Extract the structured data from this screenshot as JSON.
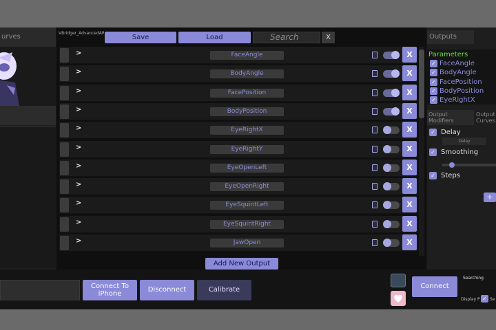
{
  "left_panel": {
    "tab_label": "urves"
  },
  "file": {
    "name": "VBridger_AdvancedARKit_V3.0"
  },
  "toolbar": {
    "save_label": "Save",
    "load_label": "Load",
    "search_placeholder": "Search",
    "search_clear": "X"
  },
  "outputs": [
    {
      "name": "FaceAngle",
      "enabled": true
    },
    {
      "name": "BodyAngle",
      "enabled": true
    },
    {
      "name": "FacePosition",
      "enabled": true
    },
    {
      "name": "BodyPosition",
      "enabled": true
    },
    {
      "name": "EyeRightX",
      "enabled": false
    },
    {
      "name": "EyeRightY",
      "enabled": false
    },
    {
      "name": "EyeOpenLeft",
      "enabled": false
    },
    {
      "name": "EyeOpenRight",
      "enabled": false
    },
    {
      "name": "EyeSquintLeft",
      "enabled": false
    },
    {
      "name": "EyeSquintRight",
      "enabled": false
    },
    {
      "name": "JawOpen",
      "enabled": false
    }
  ],
  "row_labels": {
    "expand": ">",
    "delete": "X"
  },
  "add_output_label": "Add New Output",
  "right_panel": {
    "outputs_tab": "Outputs",
    "parameters_title": "Parameters",
    "parameters": [
      "FaceAngle",
      "BodyAngle",
      "FacePosition",
      "BodyPosition",
      "EyeRightX"
    ],
    "tab_modifiers": "Output Modifiers",
    "tab_curves": "Output Curves",
    "modifiers": [
      "Delay",
      "Smoothing",
      "Steps"
    ],
    "delay_field": "Delay",
    "add_modifier": "+"
  },
  "bottom": {
    "connect_iphone": "Connect To iPhone",
    "disconnect": "Disconnect",
    "calibrate": "Calibrate",
    "connect": "Connect",
    "status": "Searching",
    "display_label": "Display P",
    "display_label_2": "Se"
  },
  "colors": {
    "accent": "#8a8ad8",
    "param_title": "#6adc4a",
    "background": "#141414"
  }
}
